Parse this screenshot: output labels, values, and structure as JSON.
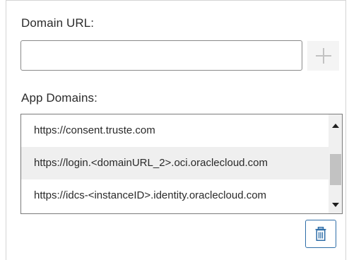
{
  "domain_url": {
    "label": "Domain URL:",
    "value": "",
    "placeholder": ""
  },
  "add_button": {
    "icon": "plus-icon"
  },
  "app_domains": {
    "label": "App Domains:",
    "items": [
      {
        "label": "https://consent.truste.com"
      },
      {
        "label": "https://login.<domainURL_2>.oci.oraclecloud.com"
      },
      {
        "label": "https://idcs-<instanceID>.identity.oraclecloud.com"
      }
    ],
    "selected_index": 1
  },
  "delete_button": {
    "icon": "trash-icon"
  },
  "colors": {
    "accent": "#2f6ea8",
    "selected_row": "#efefef",
    "scrollbar_thumb": "#c2c2c2"
  }
}
